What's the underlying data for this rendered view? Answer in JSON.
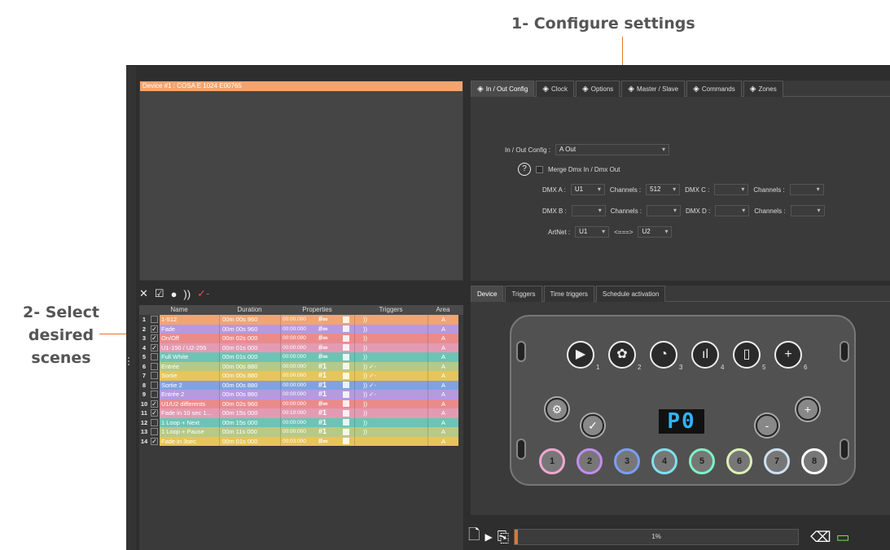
{
  "callouts": {
    "step1": "1- Configure settings",
    "step2_line1": "2- Select",
    "step2_line2": "desired",
    "step2_line3": "scenes"
  },
  "device_panel": {
    "header": "Device #1 : COSA E 1024 E00765"
  },
  "config_tabs": [
    {
      "label": "In / Out Config",
      "icon": "palette-icon"
    },
    {
      "label": "Clock",
      "icon": "clock-icon"
    },
    {
      "label": "Options",
      "icon": "gear-icon"
    },
    {
      "label": "Master / Slave",
      "icon": "windows-icon"
    },
    {
      "label": "Commands",
      "icon": "command-icon"
    },
    {
      "label": "Zones",
      "icon": "zones-icon"
    }
  ],
  "config": {
    "in_out_label": "In / Out Config :",
    "in_out_value": "A Out",
    "help": "?",
    "merge_label": "Merge Dmx In / Dmx Out",
    "dmx_a_label": "DMX A :",
    "dmx_a_value": "U1",
    "channels_label": "Channels :",
    "channels_a_value": "512",
    "dmx_c_label": "DMX C :",
    "dmx_b_label": "DMX B :",
    "dmx_d_label": "DMX D :",
    "artnet_label": "ArtNet :",
    "artnet_value": "U1",
    "arrow": "<===>",
    "artnet_value2": "U2"
  },
  "scene_toolbar": [
    "✕",
    "☑",
    "●",
    "))",
    "✓-"
  ],
  "scene_headers": {
    "name": "Name",
    "duration": "Duration",
    "properties": "Properties",
    "triggers": "Triggers",
    "area": "Area"
  },
  "scenes": [
    {
      "num": "1",
      "checked": false,
      "name": "1-512",
      "duration": "00m 00s 960",
      "time": "00:00:000",
      "hash": "#∞",
      "trig": "))",
      "area": "A",
      "color": "#f4a46e"
    },
    {
      "num": "2",
      "checked": true,
      "name": "Fade",
      "duration": "00m 00s 960",
      "time": "00:00:000",
      "hash": "#∞",
      "trig": "))",
      "area": "A",
      "color": "#b59ae0"
    },
    {
      "num": "3",
      "checked": true,
      "name": "On/Off",
      "duration": "00m 02s 000",
      "time": "00:00:000",
      "hash": "#∞",
      "trig": "))",
      "area": "A",
      "color": "#ea8b8b"
    },
    {
      "num": "4",
      "checked": true,
      "name": "U1-150 / U2-255",
      "duration": "00m 01s 000",
      "time": "00:00:000",
      "hash": "#∞",
      "trig": "))",
      "area": "A",
      "color": "#e39bb3"
    },
    {
      "num": "5",
      "checked": false,
      "name": "Full White",
      "duration": "00m 01s 000",
      "time": "00:00:000",
      "hash": "#∞",
      "trig": "))",
      "area": "A",
      "color": "#6ec3b5"
    },
    {
      "num": "6",
      "checked": false,
      "name": "Entrée",
      "duration": "00m 00s 880",
      "time": "00:00:000",
      "hash": "#1",
      "trig": ")) ✓-",
      "area": "A",
      "color": "#b7c987"
    },
    {
      "num": "7",
      "checked": false,
      "name": "Sortie",
      "duration": "00m 00s 880",
      "time": "00:00:000",
      "hash": "#1",
      "trig": ")) ✓-",
      "area": "A",
      "color": "#e6c55a"
    },
    {
      "num": "8",
      "checked": false,
      "name": "Sortie 2",
      "duration": "00m 00s 880",
      "time": "00:00:000",
      "hash": "#1",
      "trig": ")) ✓-",
      "area": "A",
      "color": "#7fa3e0"
    },
    {
      "num": "9",
      "checked": false,
      "name": "Entrée 2",
      "duration": "00m 00s 880",
      "time": "00:00:000",
      "hash": "#1",
      "trig": ")) ✓-",
      "area": "A",
      "color": "#b59ae0"
    },
    {
      "num": "10",
      "checked": true,
      "name": "U1/U2 differents",
      "duration": "00m 02s 960",
      "time": "00:00:000",
      "hash": "#∞",
      "trig": "))",
      "area": "A",
      "color": "#ea8b8b"
    },
    {
      "num": "11",
      "checked": true,
      "name": "Fade in 10 sec 1...",
      "duration": "00m 15s 000",
      "time": "00:10:000",
      "hash": "#1",
      "trig": "))",
      "area": "A",
      "color": "#e39bb3"
    },
    {
      "num": "12",
      "checked": false,
      "name": "1 Loop + Next",
      "duration": "00m 15s 000",
      "time": "00:00:000",
      "hash": "#1",
      "trig": "))",
      "area": "A",
      "color": "#6ec3b5"
    },
    {
      "num": "13",
      "checked": false,
      "name": "1 Loop + Pause",
      "duration": "00m 11s 000",
      "time": "00:00:000",
      "hash": "#1",
      "trig": "))",
      "area": "A",
      "color": "#b7c987"
    },
    {
      "num": "14",
      "checked": true,
      "name": "Fade in 3sec",
      "duration": "00m 01s 000",
      "time": "00:03:000",
      "hash": "#∞",
      "trig": "",
      "area": "A",
      "color": "#e6c55a"
    }
  ],
  "device_tabs": [
    "Device",
    "Triggers",
    "Time triggers",
    "Schedule activation"
  ],
  "device": {
    "display": "P0",
    "top_buttons": [
      {
        "icon": "play-icon",
        "glyph": "▶",
        "num": "1"
      },
      {
        "icon": "palette-icon",
        "glyph": "✿",
        "num": "2"
      },
      {
        "icon": "speed-icon",
        "glyph": "◔",
        "num": "3"
      },
      {
        "icon": "level-icon",
        "glyph": "ıl",
        "num": "4"
      },
      {
        "icon": "page-icon",
        "glyph": "▯",
        "num": "5"
      },
      {
        "icon": "plus-icon",
        "glyph": "+",
        "num": "6"
      }
    ],
    "scene_buttons": [
      {
        "label": "1",
        "color": "#f2a6d2"
      },
      {
        "label": "2",
        "color": "#c38df0"
      },
      {
        "label": "3",
        "color": "#7a9ef2"
      },
      {
        "label": "4",
        "color": "#7fe0f0"
      },
      {
        "label": "5",
        "color": "#7ef0c6"
      },
      {
        "label": "6",
        "color": "#dcf0b4"
      },
      {
        "label": "7",
        "color": "#cde0f0"
      },
      {
        "label": "8",
        "color": "#ffffff"
      }
    ],
    "minus": "-",
    "plus": "+"
  },
  "bottom_bar": {
    "progress_label": "1%",
    "progress_value": 0.01
  }
}
